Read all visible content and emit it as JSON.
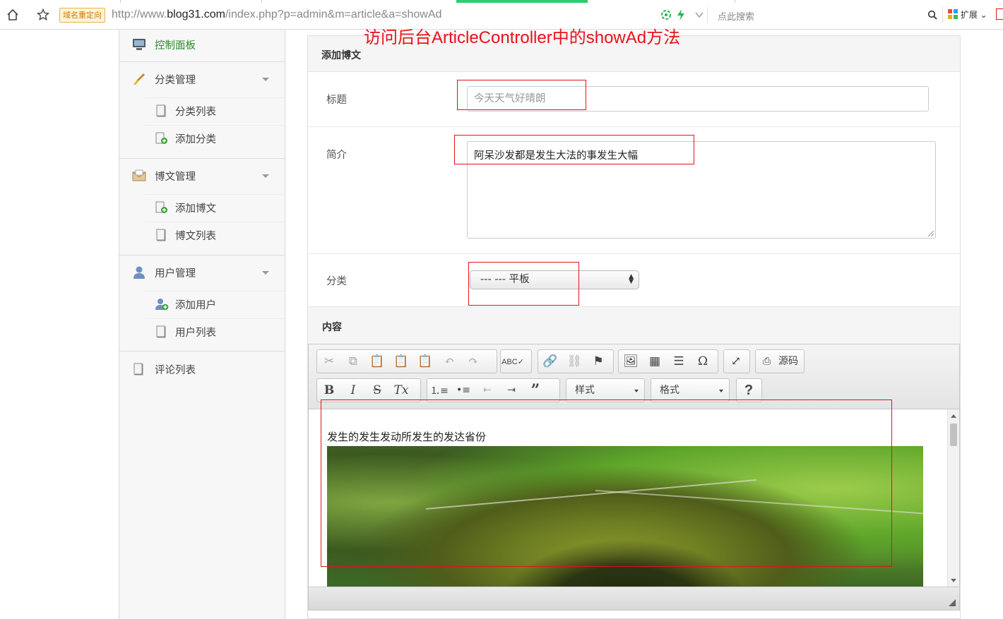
{
  "browser": {
    "redirect_badge": "域名重定向",
    "url_prefix": "http://www.",
    "url_domain": "blog31.com",
    "url_path": "/index.php?p=admin&m=article&a=showAd",
    "search_placeholder": "点此搜索",
    "extensions_label": "扩展"
  },
  "annotation": "访问后台ArticleController中的showAd方法",
  "sidebar": {
    "dashboard": "控制面板",
    "groups": [
      {
        "label": "分类管理",
        "items": [
          "分类列表",
          "添加分类"
        ]
      },
      {
        "label": "博文管理",
        "items": [
          "添加博文",
          "博文列表"
        ]
      },
      {
        "label": "用户管理",
        "items": [
          "添加用户",
          "用户列表"
        ]
      }
    ],
    "comments": "评论列表"
  },
  "form": {
    "heading": "添加博文",
    "title_label": "标题",
    "title_value": "今天天气好晴朗",
    "intro_label": "简介",
    "intro_value": "阿呆沙发都是发生大法的事发生大幅",
    "category_label": "分类",
    "category_value": "--- --- 平板",
    "content_label": "内容"
  },
  "editor": {
    "source_label": "源码",
    "styles_label": "样式",
    "format_label": "格式",
    "body_text": "发生的发生发动所发生的发达省份"
  },
  "colors": {
    "annotation": "#e8141a",
    "highlight": "#e0141a",
    "active_nav": "#2a8a2a"
  }
}
